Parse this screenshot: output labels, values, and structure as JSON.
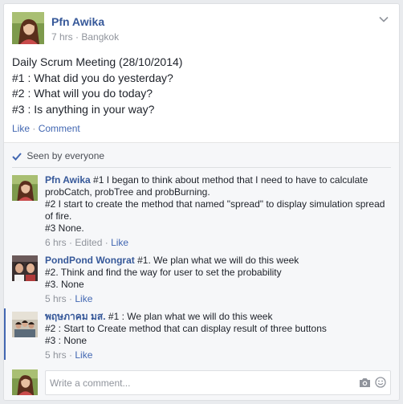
{
  "post": {
    "author": "Pfn Awika",
    "time": "7 hrs",
    "location": "Bangkok",
    "separator": "·",
    "lines": [
      "Daily Scrum Meeting (28/10/2014)",
      "#1 : What did you do yesterday?",
      "#2 : What will you do today?",
      "#3 : Is anything in your way?"
    ],
    "like_label": "Like",
    "comment_label": "Comment"
  },
  "seen": {
    "label": "Seen by everyone"
  },
  "comments": [
    {
      "author": "Pfn Awika",
      "first_line": " #1 I began to think about method that I need to have to calculate probCatch, probTree and probBurning.",
      "lines": [
        "#2 I start to create the method that named \"spread\" to display simulation spread of fire.",
        "#3 None."
      ],
      "time": "6 hrs",
      "edited": "Edited",
      "like": "Like"
    },
    {
      "author": "PondPond Wongrat",
      "first_line": " #1. We plan what we will do this week",
      "lines": [
        "#2. Think and find the way for user to set the probability",
        "#3. None"
      ],
      "time": "5 hrs",
      "like": "Like"
    },
    {
      "author": "พฤษภาคม มส.",
      "first_line": " #1 : We plan what we will do this week",
      "lines": [
        "#2 : Start to Create method that can display result of three buttons",
        "#3 : None"
      ],
      "time": "5 hrs",
      "like": "Like"
    }
  ],
  "comment_input": {
    "placeholder": "Write a comment..."
  },
  "icons": {
    "chevron": "chevron-down-icon",
    "check": "check-icon",
    "camera": "camera-icon",
    "smiley": "smiley-icon"
  },
  "colors": {
    "link": "#365899",
    "accent": "#4267b2",
    "meta": "#90949c"
  }
}
